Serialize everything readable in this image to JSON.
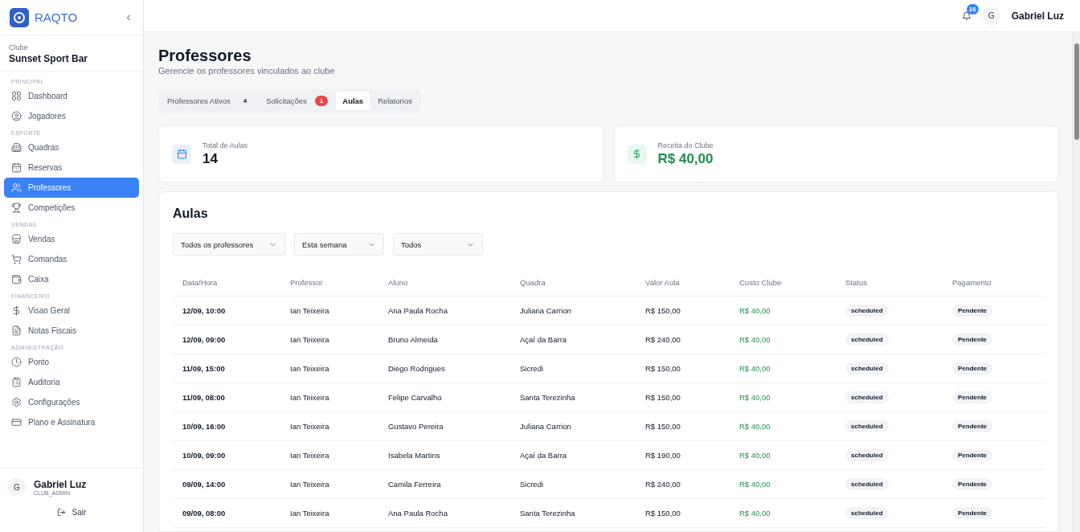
{
  "brand": {
    "name": "RAQTO"
  },
  "club": {
    "label": "Clube",
    "name": "Sunset Sport Bar"
  },
  "sidebar": {
    "sections": [
      {
        "label": "PRINCIPAL",
        "items": [
          {
            "label": "Dashboard",
            "selected": false
          },
          {
            "label": "Jogadores",
            "selected": false
          }
        ]
      },
      {
        "label": "ESPORTE",
        "items": [
          {
            "label": "Quadras",
            "selected": false
          },
          {
            "label": "Reservas",
            "selected": false
          },
          {
            "label": "Professores",
            "selected": true
          },
          {
            "label": "Competições",
            "selected": false
          }
        ]
      },
      {
        "label": "VENDAS",
        "items": [
          {
            "label": "Vendas",
            "selected": false
          },
          {
            "label": "Comandas",
            "selected": false
          },
          {
            "label": "Caixa",
            "selected": false
          }
        ]
      },
      {
        "label": "FINANCEIRO",
        "items": [
          {
            "label": "Visao Geral",
            "selected": false
          },
          {
            "label": "Notas Fiscais",
            "selected": false
          }
        ]
      },
      {
        "label": "ADMINISTRAÇÃO",
        "items": [
          {
            "label": "Ponto",
            "selected": false
          },
          {
            "label": "Auditoria",
            "selected": false
          },
          {
            "label": "Configurações",
            "selected": false
          },
          {
            "label": "Plano e Assinatura",
            "selected": false
          }
        ]
      }
    ]
  },
  "sidebar_user": {
    "initial": "G",
    "name": "Gabriel Luz",
    "role": "CLUB_ADMIN",
    "logout": "Sair"
  },
  "topbar": {
    "notifications": "16",
    "initial": "G",
    "user": "Gabriel Luz"
  },
  "page": {
    "title": "Professores",
    "subtitle": "Gerencie os professores vinculados ao clube"
  },
  "tabs": [
    {
      "label": "Professores Ativos",
      "count": "4",
      "kind": "count",
      "selected": false
    },
    {
      "label": "Solicitações",
      "count": "1",
      "kind": "alert",
      "selected": false
    },
    {
      "label": "Aulas",
      "selected": true
    },
    {
      "label": "Relatorios",
      "selected": false
    }
  ],
  "stats": [
    {
      "label": "Total de Aulas",
      "value": "14",
      "kind": "count"
    },
    {
      "label": "Receita do Clube",
      "value": "R$ 40,00",
      "kind": "money"
    }
  ],
  "lessons": {
    "title": "Aulas",
    "filters": [
      {
        "value": "Todos os professores"
      },
      {
        "value": "Esta semana"
      },
      {
        "value": "Todos"
      }
    ],
    "table": {
      "columns": [
        "Data/Hora",
        "Professor",
        "Aluno",
        "Quadra",
        "Valor Aula",
        "Custo Clube",
        "Status",
        "Pagamento"
      ],
      "rows": [
        [
          "12/09, 10:00",
          "Ian Teixeira",
          "Ana Paula Rocha",
          "Juliana Carrion",
          "R$ 150,00",
          "R$ 40,00",
          "scheduled",
          "Pendente"
        ],
        [
          "12/09, 09:00",
          "Ian Teixeira",
          "Bruno Almeida",
          "Açaí da Barra",
          "R$ 240,00",
          "R$ 40,00",
          "scheduled",
          "Pendente"
        ],
        [
          "11/09, 15:00",
          "Ian Teixeira",
          "Diego Rodrigues",
          "Sicredi",
          "R$ 150,00",
          "R$ 40,00",
          "scheduled",
          "Pendente"
        ],
        [
          "11/09, 08:00",
          "Ian Teixeira",
          "Felipe Carvalho",
          "Santa Terezinha",
          "R$ 150,00",
          "R$ 40,00",
          "scheduled",
          "Pendente"
        ],
        [
          "10/09, 16:00",
          "Ian Teixeira",
          "Gustavo Pereira",
          "Juliana Carrion",
          "R$ 150,00",
          "R$ 40,00",
          "scheduled",
          "Pendente"
        ],
        [
          "10/09, 09:00",
          "Ian Teixeira",
          "Isabela Martins",
          "Açaí da Barra",
          "R$ 190,00",
          "R$ 40,00",
          "scheduled",
          "Pendente"
        ],
        [
          "09/09, 14:00",
          "Ian Teixeira",
          "Camila Ferreira",
          "Sicredi",
          "R$ 240,00",
          "R$ 40,00",
          "scheduled",
          "Pendente"
        ],
        [
          "09/09, 08:00",
          "Ian Teixeira",
          "Ana Paula Rocha",
          "Santa Terezinha",
          "R$ 150,00",
          "R$ 40,00",
          "scheduled",
          "Pendente"
        ]
      ]
    }
  }
}
